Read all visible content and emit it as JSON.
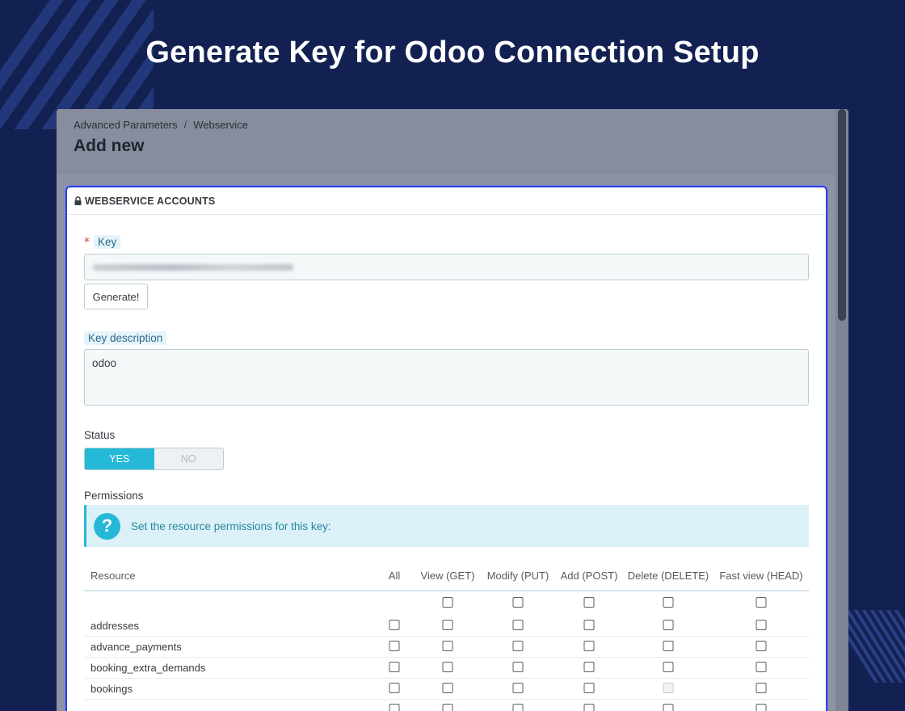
{
  "banner": {
    "title": "Generate Key for Odoo Connection Setup"
  },
  "header": {
    "breadcrumb": [
      "Advanced Parameters",
      "Webservice"
    ],
    "breadcrumb_sep": "/",
    "page_title": "Add new"
  },
  "panel": {
    "heading": "WEBSERVICE ACCOUNTS",
    "heading_icon": "lock-icon",
    "key": {
      "label": "Key",
      "required": "*",
      "value_obscured": true,
      "generate_label": "Generate!"
    },
    "key_description": {
      "label": "Key description",
      "value": "odoo"
    },
    "status": {
      "label": "Status",
      "yes": "YES",
      "no": "NO",
      "selected": "YES"
    },
    "permissions": {
      "label": "Permissions",
      "info_text": "Set the resource permissions for this key:",
      "info_icon": "question-icon",
      "columns": [
        "Resource",
        "All",
        "View (GET)",
        "Modify (PUT)",
        "Add (POST)",
        "Delete (DELETE)",
        "Fast view (HEAD)"
      ],
      "rows": [
        {
          "resource": "addresses",
          "checked": [
            false,
            false,
            false,
            false,
            false,
            false
          ],
          "disabled": [
            false,
            false,
            false,
            false,
            false,
            false
          ]
        },
        {
          "resource": "advance_payments",
          "checked": [
            false,
            false,
            false,
            false,
            false,
            false
          ],
          "disabled": [
            false,
            false,
            false,
            false,
            false,
            false
          ]
        },
        {
          "resource": "booking_extra_demands",
          "checked": [
            false,
            false,
            false,
            false,
            false,
            false
          ],
          "disabled": [
            false,
            false,
            false,
            false,
            false,
            false
          ]
        },
        {
          "resource": "bookings",
          "checked": [
            false,
            false,
            false,
            false,
            false,
            false
          ],
          "disabled": [
            false,
            false,
            false,
            false,
            true,
            false
          ]
        },
        {
          "resource": "",
          "checked": [
            false,
            false,
            false,
            false,
            false,
            false
          ],
          "disabled": [
            false,
            false,
            false,
            false,
            false,
            false
          ]
        }
      ]
    }
  },
  "colors": {
    "background": "#132152",
    "accent": "#25b9d7",
    "panel_border": "#2f43d8"
  }
}
